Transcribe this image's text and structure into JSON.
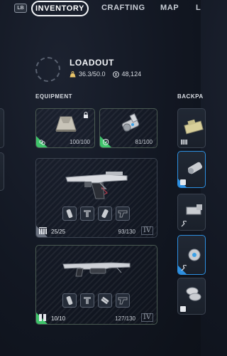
{
  "nav": {
    "lb_label": "LB",
    "tabs": [
      {
        "label": "INVENTORY",
        "active": true
      },
      {
        "label": "CRAFTING",
        "active": false
      },
      {
        "label": "MAP",
        "active": false
      },
      {
        "label": "L",
        "active": false
      }
    ]
  },
  "loadout": {
    "title": "LOADOUT",
    "weight": "36.3/50.0",
    "currency": "48,124"
  },
  "sections": {
    "equipment": "EQUIPMENT",
    "backpack": "BACKPA"
  },
  "equipment": {
    "shield": {
      "durability": "100/100"
    },
    "augment": {
      "durability": "81/100"
    },
    "weapon1": {
      "ammo": "25/25",
      "durability": "93/130",
      "tier": "IV"
    },
    "weapon2": {
      "ammo": "10/10",
      "durability": "127/130",
      "tier": "IV"
    }
  },
  "colors": {
    "accent_green": "#3ec46a",
    "accent_blue": "#2d8fe0",
    "text": "#e6e9ee"
  }
}
